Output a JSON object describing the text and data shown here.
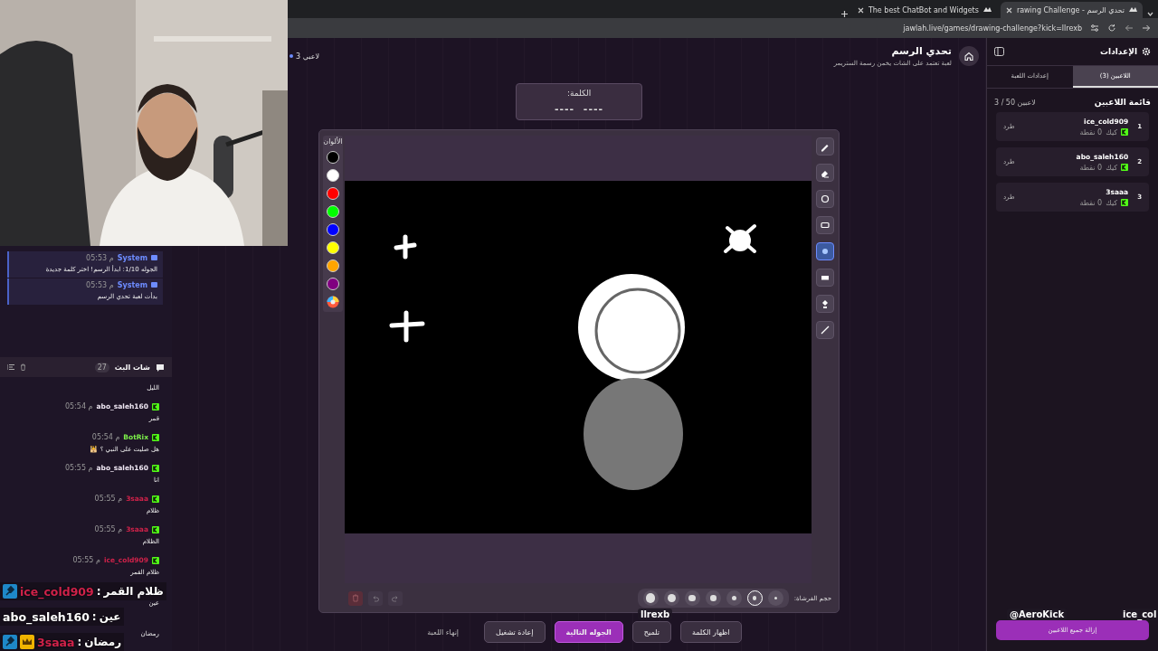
{
  "browser": {
    "tabs": [
      {
        "title": "rawing Challenge - تحدي الرسم",
        "selected": true
      },
      {
        "title": "The best ChatBot and Widgets",
        "selected": false
      }
    ],
    "url": "jawlah.live/games/drawing-challenge?kick=llrexb"
  },
  "system_messages": [
    {
      "sender": "System",
      "time": "05:53 م",
      "text": "الجوله 1/10: ابدأ الرسم! اختر كلمة جديدة"
    },
    {
      "sender": "System",
      "time": "05:53 م",
      "text": "بدأت لعبة تحدي الرسم"
    }
  ],
  "chat": {
    "title": "شات البث",
    "count": "27",
    "messages": [
      {
        "text": "الليل"
      },
      {
        "user": "abo_saleh160",
        "color": "#f0e8f4",
        "time": "05:54 م",
        "text": "قمر"
      },
      {
        "user": "BotRix",
        "color": "#7cf04a",
        "time": "05:54 م",
        "text": "هل صليت على النبي ؟ 🕌"
      },
      {
        "user": "abo_saleh160",
        "color": "#f0e8f4",
        "time": "05:55 م",
        "text": "انا"
      },
      {
        "user": "3saaa",
        "color": "#d0224a",
        "time": "05:55 م",
        "text": "ظلام"
      },
      {
        "user": "3saaa",
        "color": "#d0224a",
        "time": "05:55 م",
        "text": "الظلام"
      },
      {
        "user": "ice_cold909",
        "color": "#d0224a",
        "time": "05:55 م",
        "text": "ظلام القمر"
      },
      {
        "text": "عين"
      },
      {
        "text": "رمضان"
      }
    ]
  },
  "game": {
    "title": "تحدي الرسم",
    "subtitle": "لعبة تعتمد على الشات يخمن رسمة الستريمر",
    "players_count": "3 لاعبي",
    "word": {
      "label": "الكلمة:",
      "hint": "----  ----"
    },
    "palette": {
      "label": "الألوان",
      "colors": [
        {
          "kind": "swatch",
          "color": "#000000"
        },
        {
          "kind": "swatch",
          "color": "#ffffff"
        },
        {
          "kind": "swatch",
          "color": "#ff0000"
        },
        {
          "kind": "swatch",
          "color": "#00ff00"
        },
        {
          "kind": "swatch",
          "color": "#0000ff"
        },
        {
          "kind": "swatch",
          "color": "#ffff00"
        },
        {
          "kind": "swatch",
          "color": "#ffa500"
        },
        {
          "kind": "swatch",
          "color": "#800080"
        },
        {
          "kind": "custom"
        }
      ]
    },
    "tools": [
      {
        "kind": "pencil",
        "selected": false
      },
      {
        "kind": "eraser",
        "selected": false
      },
      {
        "kind": "circle",
        "selected": false
      },
      {
        "kind": "rectangle",
        "selected": false
      },
      {
        "kind": "dot",
        "selected": true
      },
      {
        "kind": "filled-rectangle",
        "selected": false
      },
      {
        "kind": "bucket",
        "selected": false
      },
      {
        "kind": "line",
        "selected": false
      }
    ],
    "brush": {
      "label": "حجم الفرشاة:",
      "sizes": [
        {
          "selected": false
        },
        {
          "selected": true
        },
        {
          "selected": false
        },
        {
          "selected": false
        },
        {
          "selected": false
        },
        {
          "selected": false
        },
        {
          "selected": false
        }
      ]
    },
    "buttons": [
      {
        "label": "اظهار الكلمة",
        "kind": "secondary"
      },
      {
        "label": "تلميح",
        "kind": "secondary"
      },
      {
        "label": "الجوله التالية",
        "kind": "primary"
      },
      {
        "label": "إعادة تشغيل",
        "kind": "secondary"
      },
      {
        "label": "إنهاء اللعبة",
        "kind": "link"
      }
    ]
  },
  "settings": {
    "title": "الإعدادات",
    "tabs": [
      {
        "label": "اللاعبين (3)",
        "selected": true
      },
      {
        "label": "إعدادات اللعبة",
        "selected": false
      }
    ],
    "list_title": "قائمة اللاعبين",
    "capacity": "3 / 50 لاعبين",
    "players": [
      {
        "rank": "1",
        "name": "ice_cold909",
        "platform": "كيك",
        "points": "0 نقطة",
        "action": "طرد"
      },
      {
        "rank": "2",
        "name": "abo_saleh160",
        "platform": "كيك",
        "points": "0 نقطة",
        "action": "طرد"
      },
      {
        "rank": "3",
        "name": "3saaa",
        "platform": "كيك",
        "points": "0 نقطة",
        "action": "طرد"
      }
    ],
    "remove_all": "إزالة جميع اللاعبين"
  },
  "stream_overlay": {
    "chat": [
      {
        "moderator": true,
        "vip": false,
        "user": "ice_cold909",
        "color": "#d0224a",
        "separator": ":",
        "text": "ظلام القمر"
      },
      {
        "moderator": false,
        "vip": false,
        "user": "abo_saleh160",
        "color": "#ffffff",
        "separator": ":",
        "text": "عين"
      },
      {
        "moderator": true,
        "vip": true,
        "user": "3saaa",
        "color": "#d0224a",
        "separator": ":",
        "text": "رمضان"
      }
    ],
    "name_tags": [
      "ice_col",
      "@AeroKick",
      "llrexb"
    ]
  }
}
